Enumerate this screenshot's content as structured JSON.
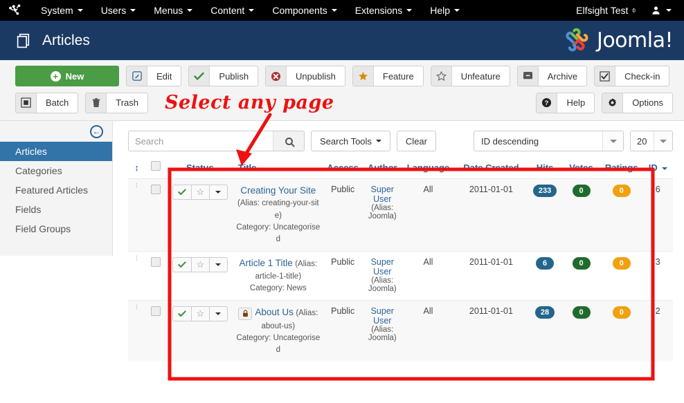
{
  "topbar": {
    "logo_icon": "joomla-logo-icon",
    "menu": [
      {
        "label": "System",
        "caret": true
      },
      {
        "label": "Users",
        "caret": true
      },
      {
        "label": "Menus",
        "caret": true
      },
      {
        "label": "Content",
        "caret": true
      },
      {
        "label": "Components",
        "caret": true
      },
      {
        "label": "Extensions",
        "caret": true
      },
      {
        "label": "Help",
        "caret": true
      }
    ],
    "site_name": "Elfsight Test",
    "site_link_icon": "external-link-icon",
    "user_icon": "user-icon"
  },
  "header": {
    "title": "Articles",
    "title_icon": "articles-icon",
    "brand": "Joomla!",
    "brand_trademark": "®"
  },
  "toolbar": {
    "new": "New",
    "edit": "Edit",
    "publish": "Publish",
    "unpublish": "Unpublish",
    "feature": "Feature",
    "unfeature": "Unfeature",
    "archive": "Archive",
    "checkin": "Check-in",
    "batch": "Batch",
    "trash": "Trash",
    "help": "Help",
    "options": "Options"
  },
  "annotation": {
    "text": "Select any page",
    "color": "#ee1111"
  },
  "sidebar": {
    "collapse_icon": "collapse-left-icon",
    "items": [
      {
        "label": "Articles",
        "active": true
      },
      {
        "label": "Categories",
        "active": false
      },
      {
        "label": "Featured Articles",
        "active": false
      },
      {
        "label": "Fields",
        "active": false
      },
      {
        "label": "Field Groups",
        "active": false
      }
    ]
  },
  "filters": {
    "search_placeholder": "Search",
    "search_value": "",
    "search_tools": "Search Tools",
    "clear": "Clear",
    "ordering_value": "ID descending",
    "limit_value": "20"
  },
  "table": {
    "columns": [
      "",
      "",
      "Status",
      "Title",
      "Access",
      "Author",
      "Language",
      "Date Created",
      "Hits",
      "Votes",
      "Ratings",
      "ID"
    ],
    "sort_column": "ID",
    "rows": [
      {
        "title": "Creating Your Site",
        "alias": "(Alias: creating-your-site)",
        "category": "Category: Uncategorised",
        "locked": false,
        "access": "Public",
        "author": "Super User",
        "author_alias": "(Alias: Joomla)",
        "language": "All",
        "date_created": "2011-01-01",
        "hits": "233",
        "votes": "0",
        "ratings": "0",
        "id": "6"
      },
      {
        "title": "Article 1 Title",
        "alias": "(Alias: article-1-title)",
        "category": "Category: News",
        "locked": false,
        "access": "Public",
        "author": "Super User",
        "author_alias": "(Alias: Joomla)",
        "language": "All",
        "date_created": "2011-01-01",
        "hits": "6",
        "votes": "0",
        "ratings": "0",
        "id": "3"
      },
      {
        "title": "About Us",
        "alias": "(Alias: about-us)",
        "category": "Category: Uncategorised",
        "locked": true,
        "lock_icon": "lock-icon",
        "access": "Public",
        "author": "Super User",
        "author_alias": "(Alias: Joomla)",
        "language": "All",
        "date_created": "2011-01-01",
        "hits": "28",
        "votes": "0",
        "ratings": "0",
        "id": "2"
      }
    ]
  },
  "colors": {
    "header_blue": "#1b3a63",
    "accent_link": "#2a6496",
    "new_green": "#4a9c45",
    "badge_hits": "#24658c",
    "badge_votes": "#1f6b2e",
    "badge_ratings": "#f0a10f",
    "annotation_red": "#ee1111"
  }
}
